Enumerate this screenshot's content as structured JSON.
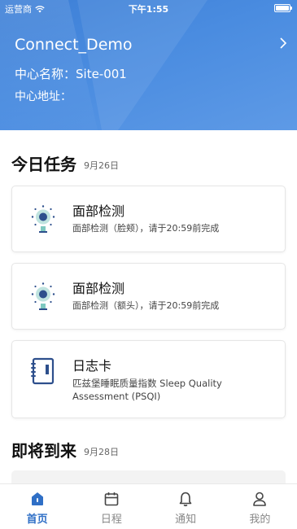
{
  "status_bar": {
    "carrier": "运营商",
    "time": "下午1:55"
  },
  "header": {
    "app_title": "Connect_Demo",
    "center_name": "中心名称：Site-001",
    "center_address": "中心地址："
  },
  "today": {
    "title": "今日任务",
    "date": "9月26日",
    "tasks": [
      {
        "title": "面部检测",
        "desc": "面部检测（脸颊），请于20:59前完成",
        "icon": "face-camera-icon"
      },
      {
        "title": "面部检测",
        "desc": "面部检测（额头），请于20:59前完成",
        "icon": "face-camera-icon"
      },
      {
        "title": "日志卡",
        "desc": "匹兹堡睡眠质量指数 Sleep Quality Assessment (PSQI)",
        "icon": "notebook-icon"
      }
    ]
  },
  "upcoming": {
    "title": "即将到来",
    "date": "9月28日"
  },
  "tabs": [
    {
      "label": "首页",
      "icon": "home-icon",
      "active": true
    },
    {
      "label": "日程",
      "icon": "calendar-icon",
      "active": false
    },
    {
      "label": "通知",
      "icon": "bell-icon",
      "active": false
    },
    {
      "label": "我的",
      "icon": "user-icon",
      "active": false
    }
  ],
  "colors": {
    "header_blue": "#4a8ce0",
    "accent": "#2f6fc6",
    "icon_teal": "#7ec9c0",
    "icon_navy": "#2d4f8c"
  }
}
